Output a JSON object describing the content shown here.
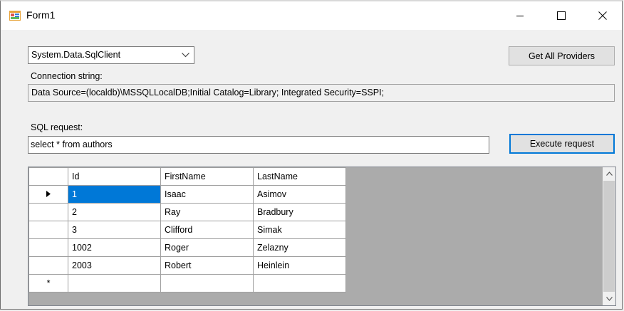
{
  "window": {
    "title": "Form1",
    "icon": "form-icon",
    "controls": [
      "minimize-icon",
      "maximize-icon",
      "close-icon"
    ]
  },
  "provider_select": {
    "value": "System.Data.SqlClient"
  },
  "buttons": {
    "get_all_providers": "Get All Providers",
    "execute_request": "Execute request"
  },
  "connection": {
    "label": "Connection string:",
    "value": "Data Source=(localdb)\\MSSQLLocalDB;Initial Catalog=Library; Integrated Security=SSPI;"
  },
  "sql": {
    "label": "SQL request:",
    "value": "select * from authors"
  },
  "grid": {
    "columns": [
      "Id",
      "FirstName",
      "LastName"
    ],
    "rows": [
      [
        "1",
        "Isaac",
        "Asimov"
      ],
      [
        "2",
        "Ray",
        "Bradbury"
      ],
      [
        "3",
        "Clifford",
        "Simak"
      ],
      [
        "1002",
        "Roger",
        "Zelazny"
      ],
      [
        "2003",
        "Robert",
        "Heinlein"
      ]
    ],
    "current_row_marker": "▶",
    "new_row_marker": "*"
  },
  "colors": {
    "selection": "#0078d7",
    "grid_background": "#ababab",
    "button_face": "#e1e1e1"
  }
}
